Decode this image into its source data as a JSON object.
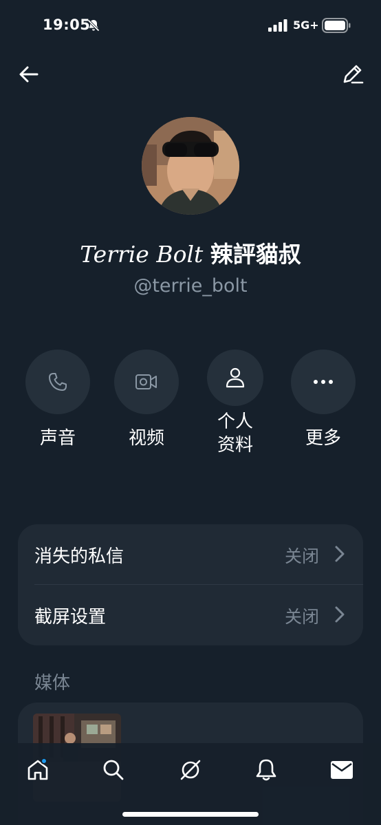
{
  "status_bar": {
    "time": "19:05",
    "network": "5G+",
    "icons": [
      "bell-slash-icon",
      "signal-icon",
      "battery-icon"
    ]
  },
  "nav": {
    "back_icon": "arrow-left-icon",
    "edit_icon": "pencil-icon"
  },
  "profile": {
    "name_latin": "Terrie Bolt",
    "name_cjk": "辣評貓叔",
    "handle": "@terrie_bolt",
    "avatar": "avatar-photo"
  },
  "actions": [
    {
      "label": "声音",
      "icon": "phone-icon"
    },
    {
      "label": "视频",
      "icon": "video-icon"
    },
    {
      "label_line1": "个人",
      "label_line2": "资料",
      "icon": "person-icon"
    },
    {
      "label": "更多",
      "icon": "more-icon"
    }
  ],
  "settings": [
    {
      "title": "消失的私信",
      "value": "关闭"
    },
    {
      "title": "截屏设置",
      "value": "关闭"
    }
  ],
  "media": {
    "header": "媒体"
  },
  "tab_bar": {
    "tabs": [
      "home-icon",
      "search-icon",
      "grok-icon",
      "notifications-icon",
      "messages-icon"
    ],
    "accent": "#1d9bf0"
  },
  "colors": {
    "background": "#16202b",
    "card": "#202a35",
    "secondary_text": "#8b98a5"
  }
}
